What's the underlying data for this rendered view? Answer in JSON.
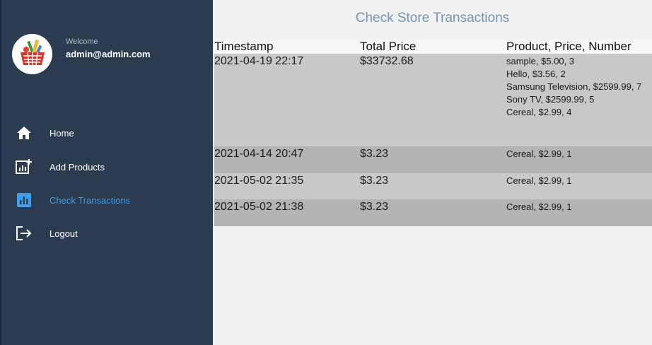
{
  "sidebar": {
    "welcome": "Welcome",
    "email": "admin@admin.com",
    "items": [
      {
        "label": "Home",
        "icon": "home-icon"
      },
      {
        "label": "Add Products",
        "icon": "add-chart-icon"
      },
      {
        "label": "Check Transactions",
        "icon": "bar-chart-icon"
      },
      {
        "label": "Logout",
        "icon": "logout-icon"
      }
    ],
    "active_color": "#3d9ff0"
  },
  "main": {
    "title": "Check Store Transactions",
    "table": {
      "headers": [
        "Timestamp",
        "Total Price",
        "Product, Price, Number"
      ],
      "rows": [
        {
          "timestamp": "2021-04-19 22:17",
          "total": "$33732.68",
          "products": [
            "sample, $5.00, 3",
            "Hello, $3.56, 2",
            "Samsung Television, $2599.99, 7",
            "Sony TV, $2599.99, 5",
            "Cereal, $2.99, 4"
          ]
        },
        {
          "timestamp": "2021-04-14 20:47",
          "total": "$3.23",
          "products": [
            "Cereal, $2.99, 1"
          ]
        },
        {
          "timestamp": "2021-05-02 21:35",
          "total": "$3.23",
          "products": [
            "Cereal, $2.99, 1"
          ]
        },
        {
          "timestamp": "2021-05-02 21:38",
          "total": "$3.23",
          "products": [
            "Cereal, $2.99, 1"
          ]
        }
      ]
    }
  }
}
